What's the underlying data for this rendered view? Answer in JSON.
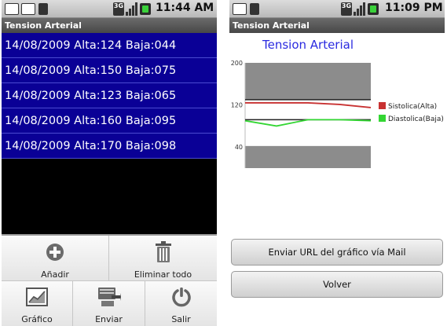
{
  "status_left": {
    "time": "11:44 AM",
    "network": "3G"
  },
  "status_right": {
    "time": "11:09 PM",
    "network": "3G"
  },
  "app": {
    "title": "Tension Arterial"
  },
  "readings": [
    "14/08/2009 Alta:124 Baja:044",
    "14/08/2009 Alta:150 Baja:075",
    "14/08/2009 Alta:123 Baja:065",
    "14/08/2009 Alta:160 Baja:095",
    "14/08/2009 Alta:170 Baja:098"
  ],
  "menu": {
    "add_label": "Añadir",
    "delete_all_label": "Eliminar todo",
    "chart_label": "Gráfico",
    "send_label": "Enviar",
    "exit_label": "Salir"
  },
  "buttons": {
    "send_url_label": "Enviar URL del gráfico vía Mail",
    "back_label": "Volver"
  },
  "colors": {
    "list_bg": "#0a0096",
    "systolic": "#c83232",
    "diastolic": "#33d633"
  },
  "chart_data": {
    "type": "line",
    "title": "Tension Arterial",
    "ylim": [
      0,
      200
    ],
    "y_ticks": [
      40,
      120,
      200
    ],
    "x": [
      1,
      2,
      3,
      4,
      5
    ],
    "series": [
      {
        "name": "Sistolica(Alta)",
        "color": "#c83232",
        "values": [
          124,
          124,
          124,
          121,
          115
        ]
      },
      {
        "name": "Diastolica(Baja)",
        "color": "#33d633",
        "values": [
          90,
          80,
          92,
          92,
          90
        ]
      }
    ],
    "reference_bands": [
      [
        0,
        42
      ],
      [
        130,
        200
      ]
    ],
    "reference_lines": [
      130,
      92
    ],
    "legend": "right"
  }
}
